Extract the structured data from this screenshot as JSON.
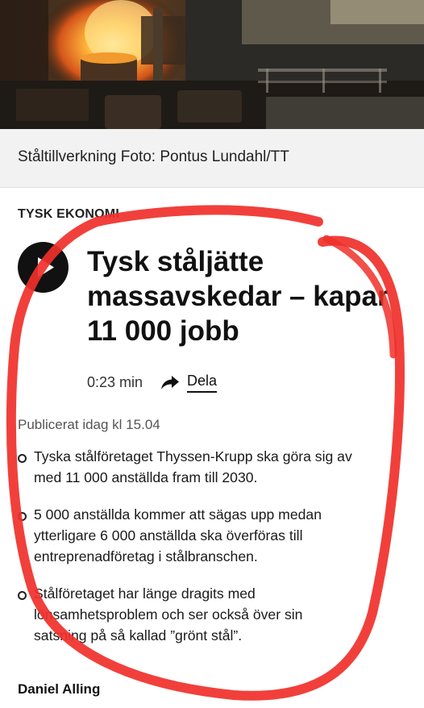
{
  "photo": {
    "caption": "Ståltillverkning Foto: Pontus Lundahl/TT"
  },
  "article": {
    "section": "TYSK EKONOMI",
    "headline_lines": [
      "Tysk ståljätte",
      "massavskedar – kapar",
      "11 000 jobb"
    ],
    "duration": "0:23 min",
    "share_label": "Dela",
    "published": "Publicerat idag kl 15.04",
    "bullets": [
      {
        "lines": [
          "Tyska stålföretaget Thyssen-Krupp ska göra sig av",
          "med 11 000 anställda fram till 2030."
        ]
      },
      {
        "lines": [
          "5 000 anställda kommer att sägas upp medan",
          "ytterligare 6 000 anställda ska överföras till",
          "entreprenadföretag i stålbranschen."
        ]
      },
      {
        "lines": [
          "Stålföretaget har länge dragits med",
          "lönsamhetsproblem och ser också över sin",
          "satsning på så kallad ”grönt stål”."
        ]
      }
    ],
    "author": "Daniel Alling"
  },
  "icons": {
    "play": "play-icon",
    "share": "share-arrow-icon"
  },
  "colors": {
    "annotation": "#f0302a",
    "caption_background": "#f2f2f2",
    "play_button": "#111111"
  }
}
